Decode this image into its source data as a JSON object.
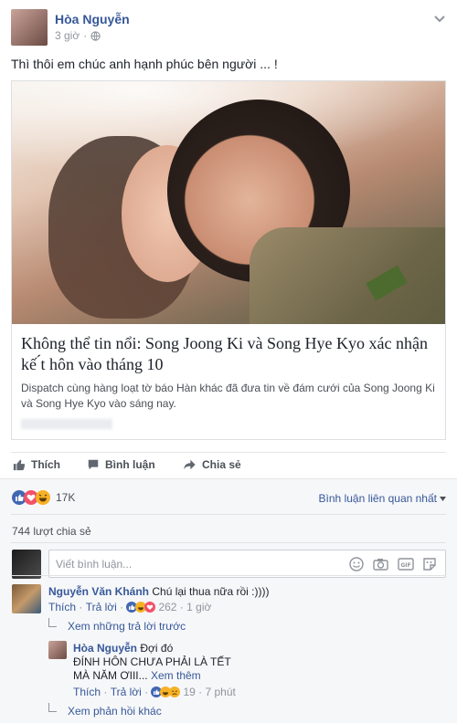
{
  "post": {
    "author": "Hòa Nguyễn",
    "time": "3 giờ",
    "text": "Thì thôi em chúc anh hạnh phúc bên người ... !"
  },
  "link_card": {
    "title": "Không thể tin nổi: Song Joong Ki và Song Hye Kyo xác nhận kế ́t hôn vào tháng 10",
    "description": "Dispatch cùng hàng loạt tờ báo Hàn khác đã đưa tin về đám cưới của Song Joong Ki và Song Hye Kyo vào sáng nay."
  },
  "actions": {
    "like": "Thích",
    "comment": "Bình luận",
    "share": "Chia sẻ"
  },
  "reactions": {
    "count": "17K",
    "sort": "Bình luận liên quan nhất"
  },
  "shares": "744 lượt chia sẻ",
  "composer": {
    "placeholder": "Viết bình luận..."
  },
  "comments": [
    {
      "author": "Nguyễn Văn Khánh",
      "text": "Chú lại thua nữa rồi :))))",
      "like": "Thích",
      "reply": "Trả lời",
      "reaction_count": "262",
      "time": "1 giờ"
    }
  ],
  "more_replies_prev": "Xem những trả lời trước",
  "reply": {
    "author": "Hòa Nguyễn",
    "text_inline": "Đợi đó",
    "line2": "ĐÍNH HÔN CHƯA PHẢI LÀ TẾT",
    "line3": "MÀ NĂM ƠIII...",
    "see_more": "Xem thêm",
    "like": "Thích",
    "reply": "Trả lời",
    "reaction_count": "19",
    "time": "7 phút"
  },
  "more_replies": "Xem phản hồi khác",
  "colors": {
    "link": "#365899",
    "meta": "#90949c",
    "like_blue": "#4267b2",
    "love_red": "#f25268",
    "haha_yellow": "#f7b125"
  }
}
